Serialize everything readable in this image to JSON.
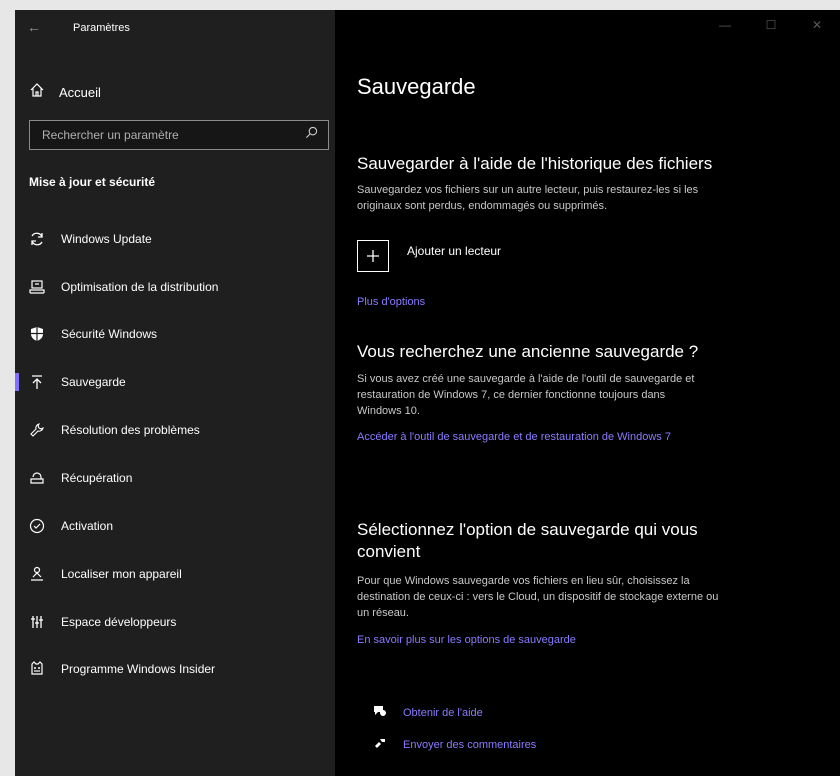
{
  "window": {
    "title": "Paramètres"
  },
  "sidebar": {
    "home_label": "Accueil",
    "search_placeholder": "Rechercher un paramètre",
    "section_title": "Mise à jour et sécurité",
    "items": [
      {
        "label": "Windows Update",
        "icon": "refresh-icon"
      },
      {
        "label": "Optimisation de la distribution",
        "icon": "delivery-icon"
      },
      {
        "label": "Sécurité Windows",
        "icon": "shield-icon"
      },
      {
        "label": "Sauvegarde",
        "icon": "backup-arrow-icon",
        "active": true
      },
      {
        "label": "Résolution des problèmes",
        "icon": "wrench-icon"
      },
      {
        "label": "Récupération",
        "icon": "recovery-icon"
      },
      {
        "label": "Activation",
        "icon": "check-circle-icon"
      },
      {
        "label": "Localiser mon appareil",
        "icon": "person-location-icon"
      },
      {
        "label": "Espace développeurs",
        "icon": "developer-icon"
      },
      {
        "label": "Programme Windows Insider",
        "icon": "insider-icon"
      }
    ]
  },
  "main": {
    "title": "Sauvegarde",
    "history": {
      "heading": "Sauvegarder à l'aide de l'historique des fichiers",
      "desc1": "Sauvegardez vos fichiers sur un autre lecteur, puis restaurez-les si les",
      "desc2": "originaux sont perdus, endommagés ou supprimés.",
      "add_drive_label": "Ajouter un lecteur",
      "more_options": "Plus d'options"
    },
    "older": {
      "heading": "Vous recherchez une ancienne sauvegarde ?",
      "desc1": "Si vous avez créé une sauvegarde à l'aide de l'outil de sauvegarde et",
      "desc2": "restauration de Windows 7, ce dernier fonctionne toujours dans",
      "desc3": "Windows 10.",
      "link": "Accéder à l'outil de sauvegarde et de restauration de Windows 7"
    },
    "select": {
      "heading1": "Sélectionnez l'option de sauvegarde qui vous",
      "heading2": "convient",
      "desc1": "Pour que Windows sauvegarde vos fichiers en lieu sûr, choisissez la",
      "desc2": "destination de ceux-ci : vers le Cloud, un dispositif de stockage externe ou",
      "desc3": "un réseau.",
      "link": "En savoir plus sur les options de sauvegarde"
    },
    "help": {
      "get_help": "Obtenir de l'aide",
      "feedback": "Envoyer des commentaires"
    }
  },
  "colors": {
    "accent": "#8470ff",
    "link": "#8a7bff",
    "sidebar_bg": "#1f1f1f",
    "main_bg": "#000000"
  }
}
